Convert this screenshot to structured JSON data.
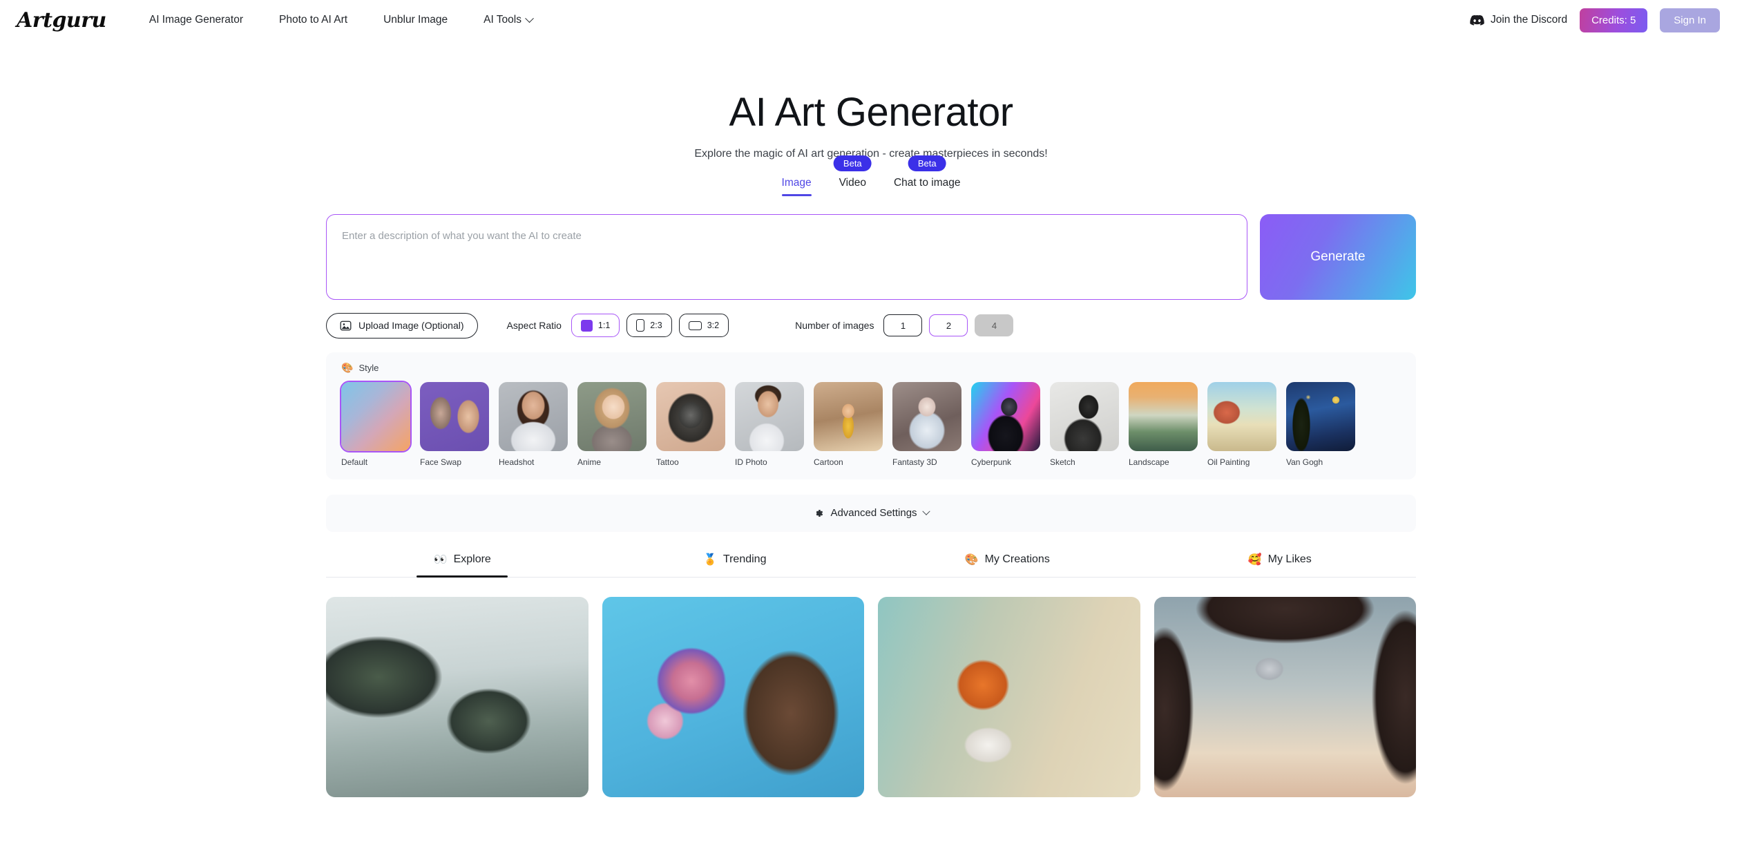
{
  "header": {
    "brand": "Artguru",
    "nav": [
      {
        "label": "AI Image Generator",
        "has_caret": false
      },
      {
        "label": "Photo to AI Art",
        "has_caret": false
      },
      {
        "label": "Unblur Image",
        "has_caret": false
      },
      {
        "label": "AI Tools",
        "has_caret": true
      }
    ],
    "discord_label": "Join the Discord",
    "credits_label": "Credits: 5",
    "signin_label": "Sign In"
  },
  "hero": {
    "title": "AI Art Generator",
    "subtitle": "Explore the magic of AI art generation - create masterpieces in seconds!"
  },
  "modes": [
    {
      "label": "Image",
      "badge": null,
      "active": true
    },
    {
      "label": "Video",
      "badge": "Beta",
      "active": false
    },
    {
      "label": "Chat to image",
      "badge": "Beta",
      "active": false
    }
  ],
  "prompt": {
    "placeholder": "Enter a description of what you want the AI to create",
    "value": "",
    "generate_label": "Generate"
  },
  "controls": {
    "upload_label": "Upload Image (Optional)",
    "aspect_ratio_label": "Aspect Ratio",
    "aspect_ratios": [
      {
        "label": "1:1",
        "selected": true
      },
      {
        "label": "2:3",
        "selected": false
      },
      {
        "label": "3:2",
        "selected": false
      }
    ],
    "number_label": "Number of images",
    "numbers": [
      {
        "label": "1",
        "selected": false,
        "disabled": false
      },
      {
        "label": "2",
        "selected": true,
        "disabled": false
      },
      {
        "label": "4",
        "selected": false,
        "disabled": true
      }
    ]
  },
  "style": {
    "section_label": "Style",
    "items": [
      {
        "label": "Default",
        "selected": true
      },
      {
        "label": "Face Swap",
        "selected": false
      },
      {
        "label": "Headshot",
        "selected": false
      },
      {
        "label": "Anime",
        "selected": false
      },
      {
        "label": "Tattoo",
        "selected": false
      },
      {
        "label": "ID Photo",
        "selected": false
      },
      {
        "label": "Cartoon",
        "selected": false
      },
      {
        "label": "Fantasty 3D",
        "selected": false
      },
      {
        "label": "Cyberpunk",
        "selected": false
      },
      {
        "label": "Sketch",
        "selected": false
      },
      {
        "label": "Landscape",
        "selected": false
      },
      {
        "label": "Oil Painting",
        "selected": false
      },
      {
        "label": "Van Gogh",
        "selected": false
      }
    ]
  },
  "advanced": {
    "label": "Advanced Settings"
  },
  "gallery_tabs": [
    {
      "label": "Explore",
      "icon": "eyes-emoji",
      "active": true
    },
    {
      "label": "Trending",
      "icon": "medal-emoji",
      "active": false
    },
    {
      "label": "My Creations",
      "icon": "palette-emoji",
      "active": false
    },
    {
      "label": "My Likes",
      "icon": "hearts-face-emoji",
      "active": false
    }
  ],
  "gallery": [
    {
      "alt": "floating sci-fi city islands with greenery"
    },
    {
      "alt": "portrait of woman with flower crown"
    },
    {
      "alt": "illustrated fox in shirt and bow tie reading"
    },
    {
      "alt": "desert landscape seen through cave arch with moons"
    }
  ],
  "colors": {
    "accent_purple": "#a855f7",
    "indigo": "#4f46e5",
    "beta_blue": "#3b30e8",
    "credits_gradient_from": "#c0409e",
    "credits_gradient_to": "#7b5cf0",
    "signin_bg": "#a9a6e0"
  }
}
